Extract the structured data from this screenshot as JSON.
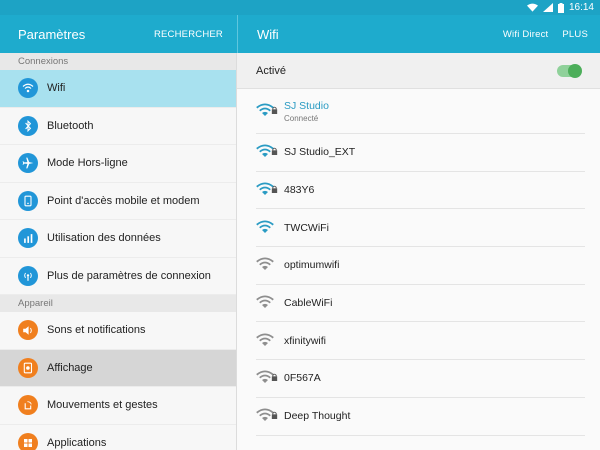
{
  "status_bar": {
    "time": "16:14"
  },
  "app_bar": {
    "left_title": "Paramètres",
    "search_label": "RECHERCHER",
    "right_title": "Wifi",
    "wifi_direct_label": "Wifi Direct",
    "more_label": "PLUS"
  },
  "sidebar": {
    "section_connexions": "Connexions",
    "section_appareil": "Appareil",
    "items": [
      {
        "label": "Wifi",
        "icon": "wifi-icon"
      },
      {
        "label": "Bluetooth",
        "icon": "bluetooth-icon"
      },
      {
        "label": "Mode Hors-ligne",
        "icon": "airplane-icon"
      },
      {
        "label": "Point d'accès mobile et modem",
        "icon": "hotspot-icon"
      },
      {
        "label": "Utilisation des données",
        "icon": "data-usage-icon"
      },
      {
        "label": "Plus de paramètres de connexion",
        "icon": "more-connections-icon"
      },
      {
        "label": "Sons et notifications",
        "icon": "speaker-icon"
      },
      {
        "label": "Affichage",
        "icon": "display-icon"
      },
      {
        "label": "Mouvements et gestes",
        "icon": "motion-icon"
      },
      {
        "label": "Applications",
        "icon": "apps-icon"
      }
    ]
  },
  "wifi": {
    "toggle_label": "Activé",
    "toggle_on": true,
    "networks": [
      {
        "name": "SJ Studio",
        "status": "Connecté",
        "secured": true,
        "signal": 4
      },
      {
        "name": "SJ Studio_EXT",
        "status": "",
        "secured": true,
        "signal": 4
      },
      {
        "name": "483Y6",
        "status": "",
        "secured": true,
        "signal": 4
      },
      {
        "name": "TWCWiFi",
        "status": "",
        "secured": false,
        "signal": 4
      },
      {
        "name": "optimumwifi",
        "status": "",
        "secured": false,
        "signal": 3
      },
      {
        "name": "CableWiFi",
        "status": "",
        "secured": false,
        "signal": 3
      },
      {
        "name": "xfinitywifi",
        "status": "",
        "secured": false,
        "signal": 3
      },
      {
        "name": "0F567A",
        "status": "",
        "secured": true,
        "signal": 3
      },
      {
        "name": "Deep Thought",
        "status": "",
        "secured": true,
        "signal": 3
      }
    ]
  },
  "colors": {
    "accent": "#1eabcd",
    "selected": "#a8e1ef",
    "connected_text": "#2a9bc3",
    "toggle_on": "#4cae5a"
  }
}
